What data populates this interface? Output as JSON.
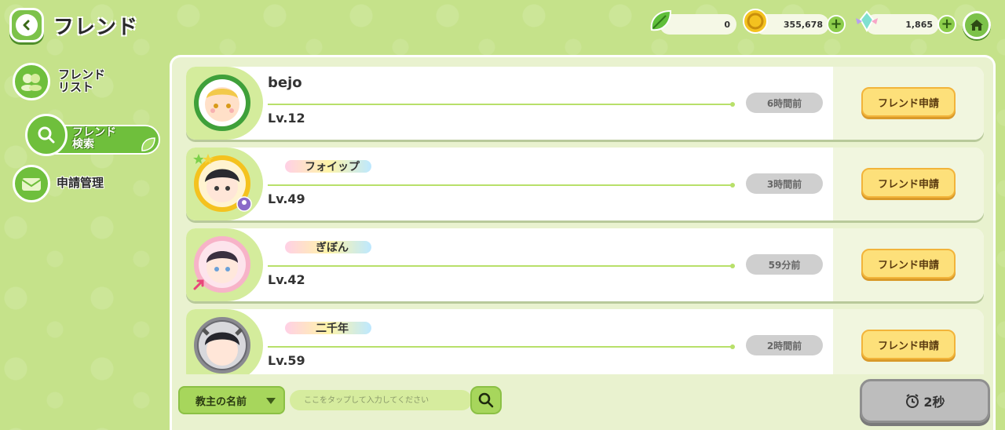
{
  "header": {
    "title": "フレンド",
    "currencies": [
      {
        "name": "leaf",
        "value": "0"
      },
      {
        "name": "coin",
        "value": "355,678"
      },
      {
        "name": "crystal",
        "value": "1,865"
      }
    ]
  },
  "sidebar": {
    "items": [
      {
        "label": "フレンド\nリスト",
        "icon": "friends-icon"
      },
      {
        "label": "フレンド\n検索",
        "icon": "search-icon",
        "active": true
      },
      {
        "label": "申請管理",
        "icon": "mail-icon"
      }
    ]
  },
  "friends": [
    {
      "name": "bejo",
      "level": "Lv.12",
      "time": "6時間前",
      "button": "フレンド申請",
      "has_title": false
    },
    {
      "name": "フォイップ",
      "level": "Lv.49",
      "time": "3時間前",
      "button": "フレンド申請",
      "has_title": true
    },
    {
      "name": "ぎぼん",
      "level": "Lv.42",
      "time": "59分前",
      "button": "フレンド申請",
      "has_title": true
    },
    {
      "name": "二千年",
      "level": "Lv.59",
      "time": "2時間前",
      "button": "フレンド申請",
      "has_title": true
    }
  ],
  "bottom": {
    "dropdown_label": "教主の名前",
    "search_placeholder": "ここをタップして入力してください",
    "timer_label": "2秒"
  },
  "colors": {
    "background": "#c5e28a",
    "accent_green": "#6fbf3c",
    "request_button": "#fde07a"
  }
}
